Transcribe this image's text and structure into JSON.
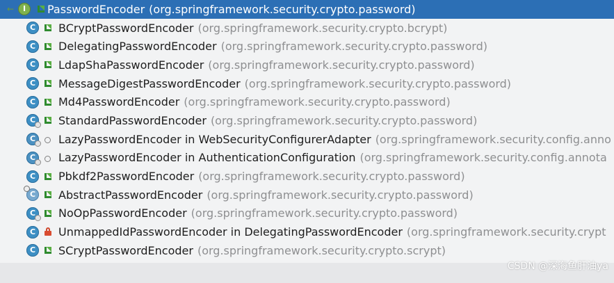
{
  "colors": {
    "selection_bg": "#2c6fb5",
    "package_text": "#8e8f91",
    "list_bg": "#f2f3f4",
    "class_icon": "#3d8fc4",
    "interface_icon": "#7fb24e"
  },
  "list": {
    "header": {
      "name": "PasswordEncoder",
      "package": "(org.springframework.security.crypto.password)",
      "icon": "interface-icon"
    },
    "items": [
      {
        "name": "BCryptPasswordEncoder",
        "package": "(org.springframework.security.crypto.bcrypt)",
        "icon": "class-icon",
        "access": "public"
      },
      {
        "name": "DelegatingPasswordEncoder",
        "package": "(org.springframework.security.crypto.password)",
        "icon": "class-icon",
        "access": "public"
      },
      {
        "name": "LdapShaPasswordEncoder",
        "package": "(org.springframework.security.crypto.password)",
        "icon": "class-icon",
        "access": "public"
      },
      {
        "name": "MessageDigestPasswordEncoder",
        "package": "(org.springframework.security.crypto.password)",
        "icon": "class-icon",
        "access": "public"
      },
      {
        "name": "Md4PasswordEncoder",
        "package": "(org.springframework.security.crypto.password)",
        "icon": "class-icon",
        "access": "public"
      },
      {
        "name": "StandardPasswordEncoder",
        "package": "(org.springframework.security.crypto.password)",
        "icon": "class-icon",
        "access": "public"
      },
      {
        "name": "LazyPasswordEncoder in WebSecurityConfigurerAdapter",
        "package": "(org.springframework.security.config.anno",
        "icon": "class-icon",
        "access": "package-private"
      },
      {
        "name": "LazyPasswordEncoder in AuthenticationConfiguration",
        "package": "(org.springframework.security.config.annota",
        "icon": "class-icon",
        "access": "package-private"
      },
      {
        "name": "Pbkdf2PasswordEncoder",
        "package": "(org.springframework.security.crypto.password)",
        "icon": "class-icon",
        "access": "public"
      },
      {
        "name": "AbstractPasswordEncoder",
        "package": "(org.springframework.security.crypto.password)",
        "icon": "abstract-class-icon",
        "access": "public"
      },
      {
        "name": "NoOpPasswordEncoder",
        "package": "(org.springframework.security.crypto.password)",
        "icon": "class-icon",
        "access": "public"
      },
      {
        "name": "UnmappedIdPasswordEncoder in DelegatingPasswordEncoder",
        "package": "(org.springframework.security.crypt",
        "icon": "class-icon",
        "access": "private"
      },
      {
        "name": "SCryptPasswordEncoder",
        "package": "(org.springframework.security.crypto.scrypt)",
        "icon": "class-icon",
        "access": "public"
      }
    ]
  },
  "watermark": "CSDN @深海鱼肝油ya"
}
